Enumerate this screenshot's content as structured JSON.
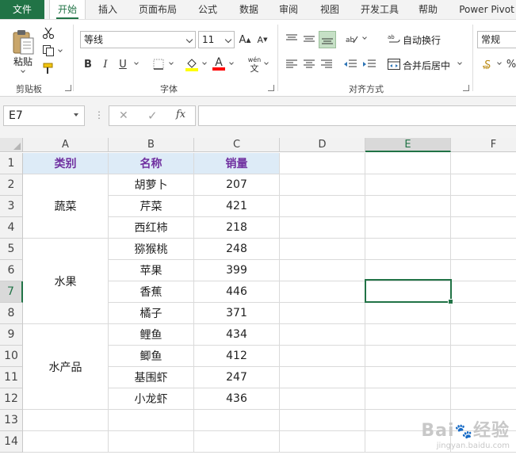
{
  "ribbon_tabs": [
    "文件",
    "开始",
    "插入",
    "页面布局",
    "公式",
    "数据",
    "审阅",
    "视图",
    "开发工具",
    "帮助",
    "Power Pivot"
  ],
  "clipboard": {
    "paste_label": "粘贴",
    "group_label": "剪贴板"
  },
  "font": {
    "name": "等线",
    "size": "11",
    "bold": "B",
    "italic": "I",
    "underline": "U",
    "wen": "wén",
    "wen2": "文",
    "group_label": "字体",
    "grow": "A",
    "shrink": "A"
  },
  "alignment": {
    "wrap_text": "自动换行",
    "merge_center": "合并后居中",
    "group_label": "对齐方式"
  },
  "number": {
    "format": "常规",
    "percent": "%"
  },
  "formula_bar": {
    "name_box": "E7",
    "cancel": "✕",
    "confirm": "✓",
    "fx": "fx",
    "formula": ""
  },
  "columns": [
    "A",
    "B",
    "C",
    "D",
    "E",
    "F"
  ],
  "rows": [
    "1",
    "2",
    "3",
    "4",
    "5",
    "6",
    "7",
    "8",
    "9",
    "10",
    "11",
    "12",
    "13",
    "14"
  ],
  "table": {
    "headers": [
      "类别",
      "名称",
      "销量"
    ],
    "categories": [
      "蔬菜",
      "水果",
      "水产品"
    ],
    "items": [
      {
        "name": "胡萝卜",
        "qty": "207"
      },
      {
        "name": "芹菜",
        "qty": "421"
      },
      {
        "name": "西红柿",
        "qty": "218"
      },
      {
        "name": "猕猴桃",
        "qty": "248"
      },
      {
        "name": "苹果",
        "qty": "399"
      },
      {
        "name": "香蕉",
        "qty": "446"
      },
      {
        "name": "橘子",
        "qty": "371"
      },
      {
        "name": "鲤鱼",
        "qty": "434"
      },
      {
        "name": "鲫鱼",
        "qty": "412"
      },
      {
        "name": "基围虾",
        "qty": "247"
      },
      {
        "name": "小龙虾",
        "qty": "436"
      }
    ]
  },
  "watermark": {
    "brand": "Bai",
    "brand2": "经验",
    "url": "jingyan.baidu.com"
  },
  "colors": {
    "excel_green": "#217346",
    "header_fill": "#ddebf7",
    "header_text": "#7030a0"
  }
}
